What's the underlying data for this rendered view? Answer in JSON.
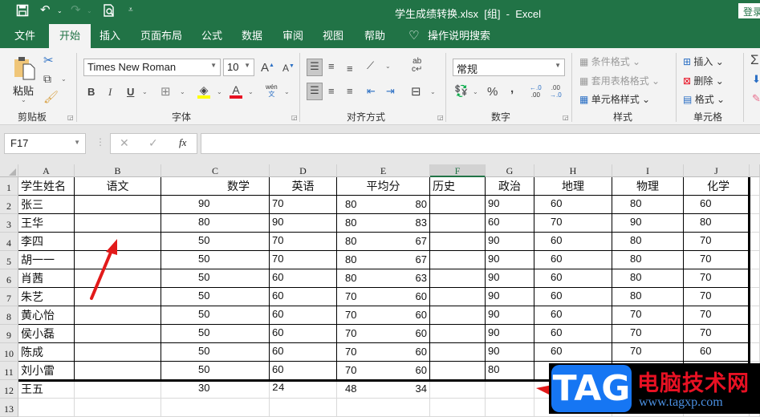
{
  "window": {
    "title": "学生成绩转换.xlsx  [组]  -  Excel",
    "login_label": "登录"
  },
  "quick_access": [
    {
      "name": "save-icon",
      "glyph": "🖫"
    },
    {
      "name": "undo-icon",
      "glyph": "↶"
    },
    {
      "name": "redo-icon",
      "glyph": "↷"
    },
    {
      "name": "print-preview-icon",
      "glyph": "🗋"
    },
    {
      "name": "customize-qat-icon",
      "glyph": "⩡"
    }
  ],
  "tabs": [
    "文件",
    "开始",
    "插入",
    "页面布局",
    "公式",
    "数据",
    "审阅",
    "视图",
    "帮助"
  ],
  "active_tab": "开始",
  "tell_me": "操作说明搜索",
  "ribbon": {
    "clipboard": {
      "paste": "粘贴",
      "label": "剪贴板"
    },
    "font": {
      "name": "Times New Roman",
      "size": "10",
      "bold": "B",
      "italic": "I",
      "underline": "U",
      "phonetic": "wén",
      "label": "字体",
      "fill_color": "#ffff00",
      "font_color": "#e81123"
    },
    "alignment": {
      "label": "对齐方式"
    },
    "number": {
      "format": "常规",
      "percent": "%",
      "comma": ",",
      "label": "数字"
    },
    "styles": {
      "conditional": "条件格式",
      "table": "套用表格格式",
      "cell_styles": "单元格样式",
      "label": "样式"
    },
    "cells": {
      "insert": "插入",
      "delete": "删除",
      "format": "格式",
      "label": "单元格"
    }
  },
  "formula_bar": {
    "name_box": "F17",
    "cancel": "✕",
    "enter": "✓",
    "fx": "fx",
    "value": ""
  },
  "columns": [
    "A",
    "B",
    "C",
    "D",
    "E",
    "F",
    "G",
    "H",
    "I",
    "J"
  ],
  "selected_column": "F",
  "rows": [
    [
      "学生姓名",
      "语文",
      "数学",
      "英语",
      "平均分",
      "历史",
      "政治",
      "地理",
      "物理",
      "化学"
    ],
    [
      "张三",
      "",
      "90",
      "70",
      "80",
      "80",
      "",
      "90",
      "60",
      "80",
      "60"
    ],
    [
      "王华",
      "",
      "80",
      "90",
      "80",
      "83",
      "",
      "60",
      "70",
      "90",
      "80"
    ],
    [
      "李四",
      "",
      "50",
      "70",
      "80",
      "67",
      "",
      "90",
      "60",
      "80",
      "70"
    ],
    [
      "胡一一",
      "",
      "50",
      "70",
      "80",
      "67",
      "",
      "90",
      "60",
      "80",
      "70"
    ],
    [
      "肖茜",
      "",
      "50",
      "60",
      "80",
      "63",
      "",
      "90",
      "60",
      "80",
      "70"
    ],
    [
      "朱艺",
      "",
      "50",
      "60",
      "70",
      "60",
      "",
      "90",
      "60",
      "80",
      "70"
    ],
    [
      "黄心怡",
      "",
      "50",
      "60",
      "70",
      "60",
      "",
      "90",
      "60",
      "70",
      "70"
    ],
    [
      "侯小磊",
      "",
      "50",
      "60",
      "70",
      "60",
      "",
      "90",
      "60",
      "70",
      "70"
    ],
    [
      "陈成",
      "",
      "50",
      "60",
      "70",
      "60",
      "",
      "90",
      "60",
      "70",
      "60"
    ],
    [
      "刘小雷",
      "",
      "50",
      "60",
      "70",
      "60",
      "",
      "80",
      "",
      "",
      ""
    ],
    [
      "王五",
      "",
      "30",
      "24",
      "48",
      "34",
      "",
      "",
      "",
      "",
      ""
    ]
  ],
  "row_numbers": [
    "1",
    "2",
    "3",
    "4",
    "5",
    "6",
    "7",
    "8",
    "9",
    "10",
    "11",
    "12",
    "13"
  ],
  "watermark": {
    "logo": "TAG",
    "text": "电脑技术网",
    "url": "www.tagxp.com"
  }
}
